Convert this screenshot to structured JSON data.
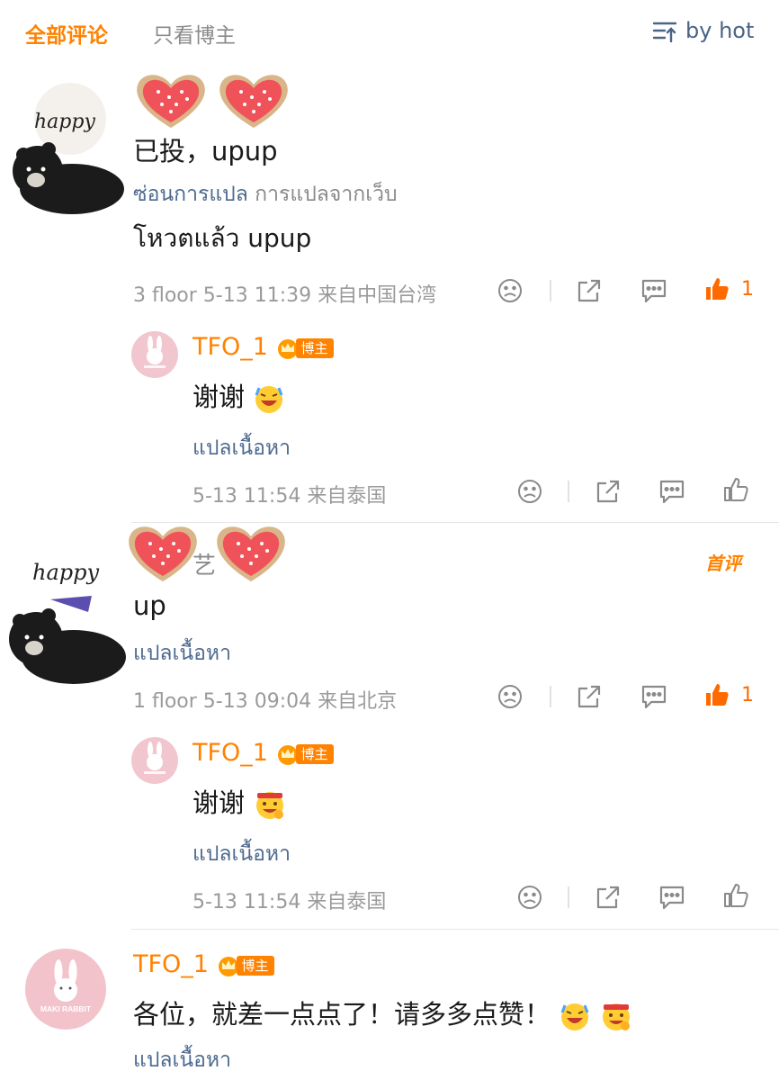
{
  "header": {
    "tab_all": "全部评论",
    "tab_author": "只看博主",
    "sort_label": "by hot"
  },
  "comments": [
    {
      "text": "已投，upup",
      "translate_hide": "ซ่อนการแปล",
      "translate_source": "การแปลจากเว็บ",
      "translation": "โหวตแล้ว upup",
      "meta": "3 floor 5-13 11:39 来自中国台湾",
      "like_count": "1",
      "reply": {
        "name": "TFO_1",
        "badge": "博主",
        "text": "谢谢",
        "translate": "แปลเนื้อหา",
        "meta": "5-13 11:54 来自泰国"
      }
    },
    {
      "name_fragment": "艺",
      "first_label": "首评",
      "text": "up",
      "translate": "แปลเนื้อหา",
      "meta": "1 floor 5-13 09:04 来自北京",
      "like_count": "1",
      "reply": {
        "name": "TFO_1",
        "badge": "博主",
        "text": "谢谢",
        "translate": "แปลเนื้อหา",
        "meta": "5-13 11:54 来自泰国"
      }
    },
    {
      "name": "TFO_1",
      "badge": "博主",
      "text": "各位，就差一点点了！请多多点赞！",
      "translate": "แปลเนื้อหา",
      "avatar_text": "MAKI RABBIT"
    }
  ],
  "icons": {
    "sort": "sort-icon",
    "dislike": "dislike-icon",
    "share": "share-icon",
    "comment": "comment-icon",
    "like": "thumb-up-icon"
  },
  "colors": {
    "accent": "#ff8200",
    "link": "#4d6a8f",
    "meta": "#9a9a9a"
  }
}
